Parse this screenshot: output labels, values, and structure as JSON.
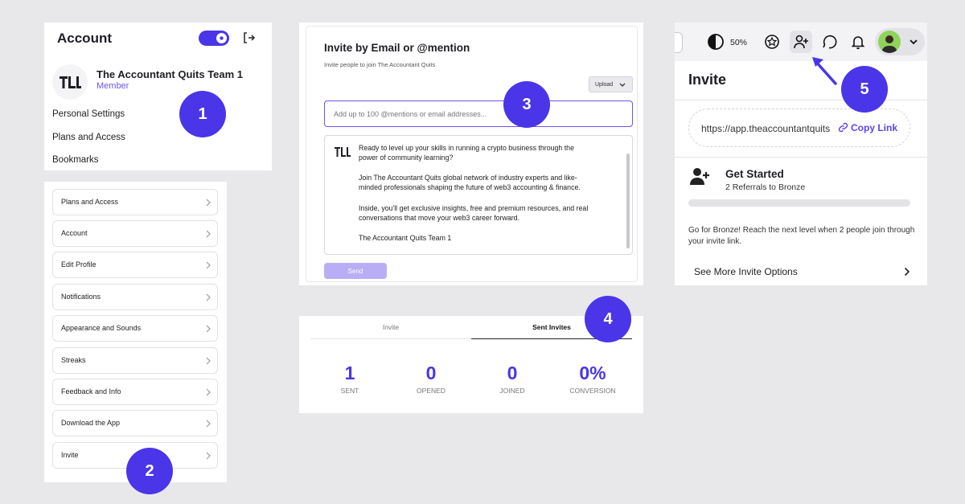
{
  "account_panel": {
    "title": "Account",
    "team_name": "The Accountant Quits Team 1",
    "role": "Member",
    "menu": [
      "Personal Settings",
      "Plans and Access",
      "Bookmarks"
    ]
  },
  "settings_list": {
    "items": [
      "Plans and Access",
      "Account",
      "Edit Profile",
      "Notifications",
      "Appearance and Sounds",
      "Streaks",
      "Feedback and Info",
      "Download the App",
      "Invite"
    ]
  },
  "invite_email": {
    "title": "Invite by Email or @mention",
    "subtitle": "Invite people to join The Accountant Quits",
    "upload_label": "Upload",
    "input_placeholder": "Add up to 100 @mentions or email addresses...",
    "message_lines": [
      "Ready to level up your skills in running a crypto business through the",
      "power of community learning?",
      "Join The Accountant Quits global network of industry experts and like-",
      "minded professionals shaping the future of web3 accounting & finance.",
      "Inside, you'll get exclusive insights, free and premium resources, and real",
      "conversations that move your web3 career forward.",
      "The Accountant Quits Team 1"
    ],
    "send_label": "Send"
  },
  "sent_stats": {
    "tabs": [
      "Invite",
      "Sent Invites"
    ],
    "active_tab": "Sent Invites",
    "stats": [
      {
        "value": "1",
        "label": "SENT"
      },
      {
        "value": "0",
        "label": "OPENED"
      },
      {
        "value": "0",
        "label": "JOINED"
      },
      {
        "value": "0%",
        "label": "CONVERSION"
      }
    ]
  },
  "topbar": {
    "zoom": "50%"
  },
  "invite_popover": {
    "title": "Invite",
    "link_text": "https://app.theaccountantquits.com",
    "copy_label": "Copy Link",
    "goal_title": "Get Started",
    "goal_subtitle": "2 Referrals to Bronze",
    "progress": 0,
    "note": "Go for Bronze! Reach the next level when 2 people join through your invite link.",
    "more_label": "See More Invite Options"
  },
  "badges": [
    "1",
    "2",
    "3",
    "4",
    "5"
  ],
  "colors": {
    "accent": "#4a35e8",
    "link": "#5b45ee",
    "background": "#e8e8ea"
  }
}
